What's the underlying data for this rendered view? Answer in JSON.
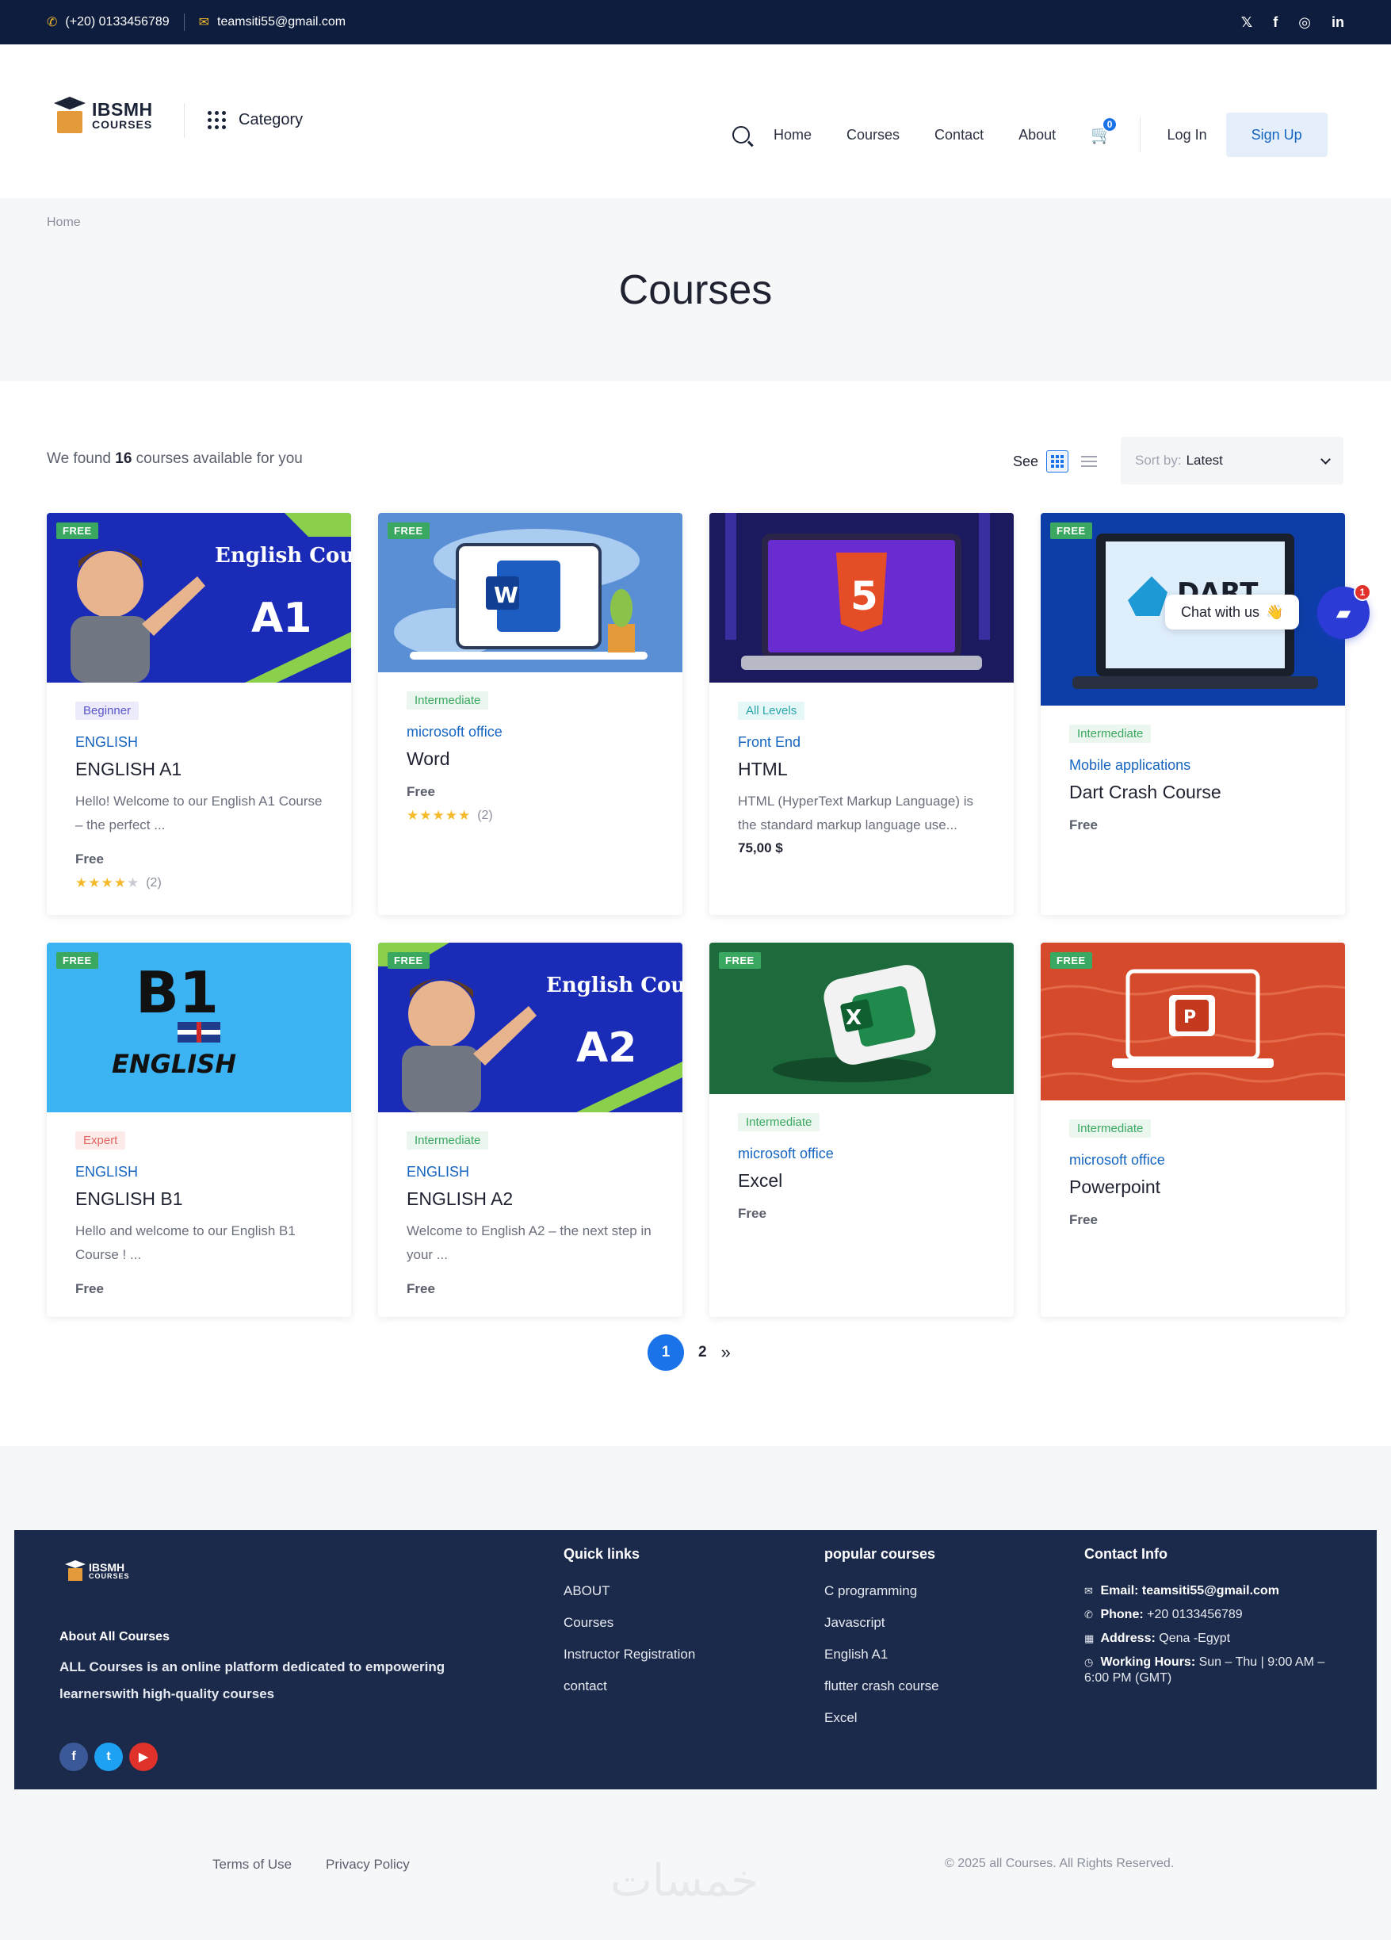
{
  "topbar": {
    "phone": "(+20) 0133456789",
    "email": "teamsiti55@gmail.com",
    "social_icons": [
      "x-icon",
      "facebook-icon",
      "instagram-icon",
      "linkedin-icon"
    ],
    "social_glyphs": [
      "𝕏",
      "f",
      "◎",
      "in"
    ]
  },
  "header": {
    "logo_line1": "IBSMH",
    "logo_line2": "COURSES",
    "category_label": "Category",
    "nav": [
      "Home",
      "Courses",
      "Contact",
      "About"
    ],
    "cart_count": "0",
    "login_label": "Log In",
    "signup_label": "Sign Up"
  },
  "band": {
    "breadcrumb": "Home",
    "title": "Courses"
  },
  "toolbar": {
    "found_prefix": "We found ",
    "found_count": "16",
    "found_suffix": " courses available for you",
    "see_label": "See",
    "sort_label": "Sort by:",
    "sort_value": "Latest"
  },
  "cards": [
    {
      "free": "FREE",
      "level": "Beginner",
      "category": "ENGLISH",
      "title": "ENGLISH A1",
      "desc": "Hello! Welcome to our English A1 Course – the perfect ...",
      "price": "Free",
      "rating_text": "(2)",
      "art_title": "English Course",
      "art_big": "A1"
    },
    {
      "free": "FREE",
      "level": "Intermediate",
      "category": "microsoft office",
      "title": "Word",
      "price": "Free",
      "rating_text": "(2)",
      "art_letter": "W"
    },
    {
      "level": "All Levels",
      "category": "Front End",
      "title": "HTML",
      "desc": "HTML (HyperText Markup Language) is the standard markup language use...",
      "price": "75,00 $",
      "art_letter": "5"
    },
    {
      "free": "FREE",
      "level": "Intermediate",
      "category": "Mobile applications",
      "title": "Dart Crash Course",
      "price": "Free",
      "art_word": "DART"
    },
    {
      "free": "FREE",
      "level": "Expert",
      "category": "ENGLISH",
      "title": "ENGLISH B1",
      "desc": "Hello and welcome to our English B1 Course !   ...",
      "price": "Free",
      "art_big": "B1",
      "art_word": "ENGLISH"
    },
    {
      "free": "FREE",
      "level": "Intermediate",
      "category": "ENGLISH",
      "title": "ENGLISH A2",
      "desc": "Welcome to English A2 – the next step in your ...",
      "price": "Free",
      "art_title": "English Course",
      "art_big": "A2"
    },
    {
      "free": "FREE",
      "level": "Intermediate",
      "category": "microsoft office",
      "title": "Excel",
      "price": "Free",
      "art_letter": "X"
    },
    {
      "free": "FREE",
      "level": "Intermediate",
      "category": "microsoft office",
      "title": "Powerpoint",
      "price": "Free",
      "art_letter": "P"
    }
  ],
  "pagination": {
    "pages": [
      "1",
      "2"
    ],
    "next": "»"
  },
  "chat": {
    "label": "Chat with us",
    "emoji": "👋",
    "badge": "1"
  },
  "footer": {
    "logo_line1": "IBSMH",
    "logo_line2": "COURSES",
    "about_heading": "About All Courses",
    "about_text": "ALL Courses is an online platform dedicated to empowering learnerswith high-quality courses",
    "quick_links_heading": "Quick links",
    "quick_links": [
      "ABOUT",
      "Courses",
      "Instructor Registration",
      "contact"
    ],
    "popular_heading": "popular courses",
    "popular": [
      "C programming",
      "Javascript",
      "English A1",
      "flutter crash course",
      "Excel"
    ],
    "contact_heading": "Contact Info",
    "contact": {
      "email_label": "Email:",
      "email": "teamsiti55@gmail.com",
      "phone_label": "Phone:",
      "phone": "+20 0133456789",
      "address_label": "Address:",
      "address": "Qena -Egypt",
      "hours_label": "Working Hours:",
      "hours": "Sun – Thu | 9:00 AM – 6:00 PM (GMT)"
    },
    "terms": "Terms of Use",
    "privacy": "Privacy Policy",
    "copyright": "© 2025 all Courses. All Rights Reserved.",
    "watermark": "خمسات"
  },
  "colors": {
    "accent": "#1a73e8",
    "navy": "#0e1d3d",
    "footer": "#1b2a4a",
    "free_tag": "#3aa860"
  }
}
